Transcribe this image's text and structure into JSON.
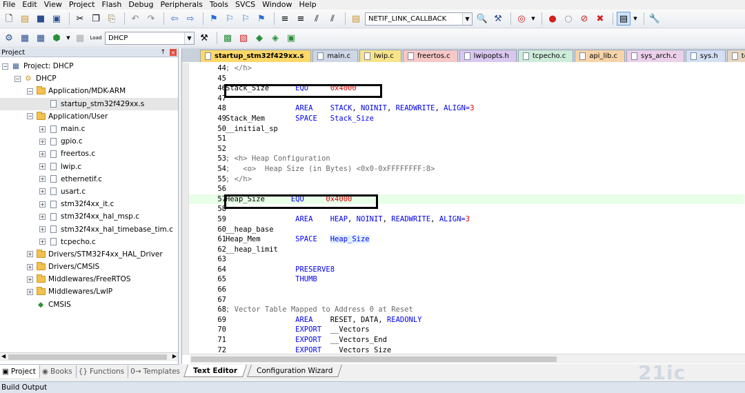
{
  "menu": [
    "File",
    "Edit",
    "View",
    "Project",
    "Flash",
    "Debug",
    "Peripherals",
    "Tools",
    "SVCS",
    "Window",
    "Help"
  ],
  "toolbar1": {
    "function_combo": "NETIF_LINK_CALLBACK"
  },
  "toolbar2": {
    "target_combo": "DHCP",
    "load_label": "Load"
  },
  "project_panel": {
    "title": "Project",
    "pin_glyph": "↑",
    "close_glyph": "×",
    "tree": [
      {
        "label": "Project: DHCP",
        "indent": 0,
        "expander": "−",
        "icon": "project"
      },
      {
        "label": "DHCP",
        "indent": 1,
        "expander": "−",
        "icon": "target"
      },
      {
        "label": "Application/MDK-ARM",
        "indent": 2,
        "expander": "−",
        "icon": "folder"
      },
      {
        "label": "startup_stm32f429xx.s",
        "indent": 3,
        "expander": "",
        "icon": "file",
        "selected": true
      },
      {
        "label": "Application/User",
        "indent": 2,
        "expander": "−",
        "icon": "folder"
      },
      {
        "label": "main.c",
        "indent": 3,
        "expander": "+",
        "icon": "file"
      },
      {
        "label": "gpio.c",
        "indent": 3,
        "expander": "+",
        "icon": "file"
      },
      {
        "label": "freertos.c",
        "indent": 3,
        "expander": "+",
        "icon": "file"
      },
      {
        "label": "lwip.c",
        "indent": 3,
        "expander": "+",
        "icon": "file"
      },
      {
        "label": "ethernetif.c",
        "indent": 3,
        "expander": "+",
        "icon": "file"
      },
      {
        "label": "usart.c",
        "indent": 3,
        "expander": "+",
        "icon": "file"
      },
      {
        "label": "stm32f4xx_it.c",
        "indent": 3,
        "expander": "+",
        "icon": "file"
      },
      {
        "label": "stm32f4xx_hal_msp.c",
        "indent": 3,
        "expander": "+",
        "icon": "file"
      },
      {
        "label": "stm32f4xx_hal_timebase_tim.c",
        "indent": 3,
        "expander": "+",
        "icon": "file"
      },
      {
        "label": "tcpecho.c",
        "indent": 3,
        "expander": "+",
        "icon": "file"
      },
      {
        "label": "Drivers/STM32F4xx_HAL_Driver",
        "indent": 2,
        "expander": "+",
        "icon": "folder"
      },
      {
        "label": "Drivers/CMSIS",
        "indent": 2,
        "expander": "+",
        "icon": "folder"
      },
      {
        "label": "Middlewares/FreeRTOS",
        "indent": 2,
        "expander": "+",
        "icon": "folder"
      },
      {
        "label": "Middlewares/LwIP",
        "indent": 2,
        "expander": "+",
        "icon": "folder"
      },
      {
        "label": "CMSIS",
        "indent": 2,
        "expander": "",
        "icon": "diamond"
      }
    ]
  },
  "left_tabs": [
    {
      "label": "Project",
      "icon": "▣",
      "active": true
    },
    {
      "label": "Books",
      "icon": "◉",
      "active": false
    },
    {
      "label": "Functions",
      "icon": "{}",
      "active": false
    },
    {
      "label": "Templates",
      "icon": "0→",
      "active": false
    }
  ],
  "file_tabs": [
    {
      "label": "startup_stm32f429xx.s",
      "color": "#ffd968",
      "active": true
    },
    {
      "label": "main.c",
      "color": "#cfd7e6",
      "active": false
    },
    {
      "label": "lwip.c",
      "color": "#f7e38a",
      "active": false
    },
    {
      "label": "freertos.c",
      "color": "#f6c8c8",
      "active": false
    },
    {
      "label": "lwipopts.h",
      "color": "#d9c7ef",
      "active": false
    },
    {
      "label": "tcpecho.c",
      "color": "#cdecd9",
      "active": false
    },
    {
      "label": "api_lib.c",
      "color": "#f6d3a8",
      "active": false
    },
    {
      "label": "sys_arch.c",
      "color": "#ecd0ea",
      "active": false
    },
    {
      "label": "sys.h",
      "color": "#d3dff3",
      "active": false
    },
    {
      "label": "tcp",
      "color": "#e9d6c0",
      "active": false
    }
  ],
  "code_lines": [
    {
      "n": "44",
      "t": "; </h>",
      "k": "cm"
    },
    {
      "n": "45",
      "t": ""
    },
    {
      "n": "46",
      "t": "Stack_Size      EQU     0x4000",
      "k": "stack_size"
    },
    {
      "n": "47",
      "t": ""
    },
    {
      "n": "48",
      "t": "                AREA    STACK, NOINIT, READWRITE, ALIGN=3",
      "k": "area3"
    },
    {
      "n": "49",
      "t": "Stack_Mem       SPACE   Stack_Size",
      "k": "space"
    },
    {
      "n": "50",
      "t": "__initial_sp"
    },
    {
      "n": "51",
      "t": ""
    },
    {
      "n": "52",
      "t": ""
    },
    {
      "n": "53",
      "t": "; <h> Heap Configuration",
      "k": "cm"
    },
    {
      "n": "54",
      "t": ";   <o>  Heap Size (in Bytes) <0x0-0xFFFFFFFF:8>",
      "k": "cm"
    },
    {
      "n": "55",
      "t": "; </h>",
      "k": "cm"
    },
    {
      "n": "56",
      "t": ""
    },
    {
      "n": "57",
      "t": "Heap_Size      EQU     0x4000",
      "k": "heap_size",
      "hl": true
    },
    {
      "n": "58",
      "t": ""
    },
    {
      "n": "59",
      "t": "                AREA    HEAP, NOINIT, READWRITE, ALIGN=3",
      "k": "area3"
    },
    {
      "n": "60",
      "t": "__heap_base"
    },
    {
      "n": "61",
      "t": "Heap_Mem        SPACE   Heap_Size",
      "k": "space_hl"
    },
    {
      "n": "62",
      "t": "__heap_limit"
    },
    {
      "n": "63",
      "t": ""
    },
    {
      "n": "64",
      "t": "                PRESERVE8",
      "k": "kwline"
    },
    {
      "n": "65",
      "t": "                THUMB",
      "k": "kwline"
    },
    {
      "n": "66",
      "t": ""
    },
    {
      "n": "67",
      "t": ""
    },
    {
      "n": "68",
      "t": "; Vector Table Mapped to Address 0 at Reset",
      "k": "cm"
    },
    {
      "n": "69",
      "t": "                AREA    RESET, DATA, READONLY",
      "k": "area_ro"
    },
    {
      "n": "70",
      "t": "                EXPORT  __Vectors",
      "k": "export"
    },
    {
      "n": "71",
      "t": "                EXPORT  __Vectors_End",
      "k": "export"
    },
    {
      "n": "72",
      "t": "                EXPORT  __Vectors_Size",
      "k": "export"
    }
  ],
  "editor_tabs": [
    {
      "label": "Text Editor",
      "active": true
    },
    {
      "label": "Configuration Wizard",
      "active": false
    }
  ],
  "build_output": {
    "title": "Build Output"
  },
  "watermark": "21ic"
}
